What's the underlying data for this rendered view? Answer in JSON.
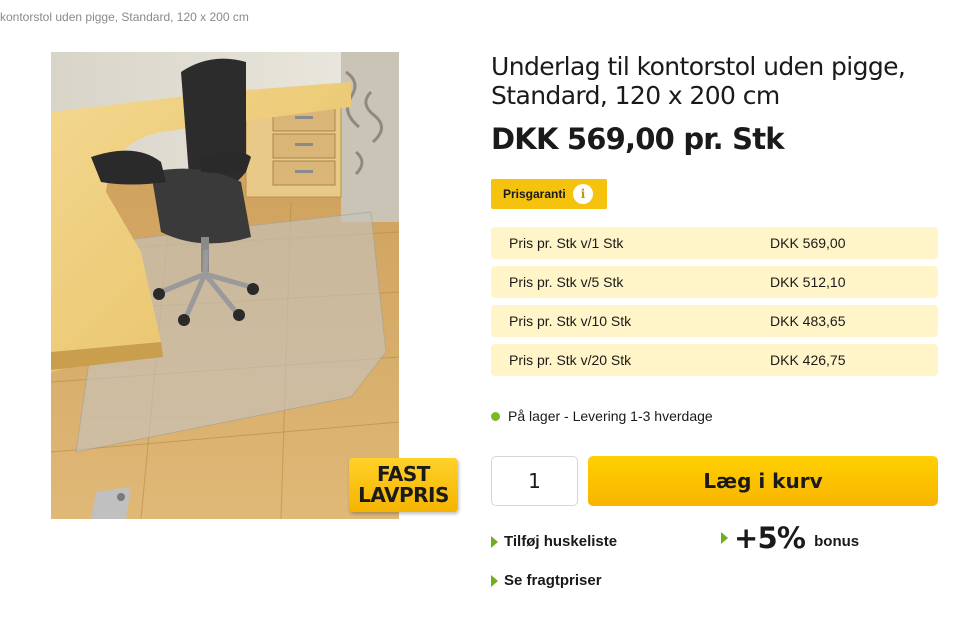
{
  "breadcrumb": "kontorstol uden pigge, Standard, 120 x 200 cm",
  "product": {
    "title": "Underlag til kontorstol uden pigge, Standard, 120 x 200 cm",
    "price": "DKK 569,00 pr. Stk",
    "image_alt": "Kontorstol på gennemsigtigt underlag på trægulv",
    "badge_line1": "FAST",
    "badge_line2": "LAVPRIS"
  },
  "prisgaranti": {
    "label": "Prisgaranti",
    "info_icon": "i"
  },
  "price_tiers": [
    {
      "qty": "Pris pr. Stk v/1 Stk",
      "price": "DKK 569,00"
    },
    {
      "qty": "Pris pr. Stk v/5 Stk",
      "price": "DKK 512,10"
    },
    {
      "qty": "Pris pr. Stk v/10 Stk",
      "price": "DKK 483,65"
    },
    {
      "qty": "Pris pr. Stk v/20 Stk",
      "price": "DKK 426,75"
    }
  ],
  "stock": {
    "text": "På lager - Levering 1-3 hverdage",
    "status_color": "#7ab828"
  },
  "cart": {
    "quantity": "1",
    "button_label": "Læg i kurv"
  },
  "links": {
    "wishlist": "Tilføj huskeliste",
    "freight": "Se fragtpriser"
  },
  "bonus": {
    "percent": "+5%",
    "label": "bonus"
  },
  "colors": {
    "accent": "#f5c20e",
    "tier_bg": "#fff5c8",
    "arrow": "#6fae1f"
  }
}
